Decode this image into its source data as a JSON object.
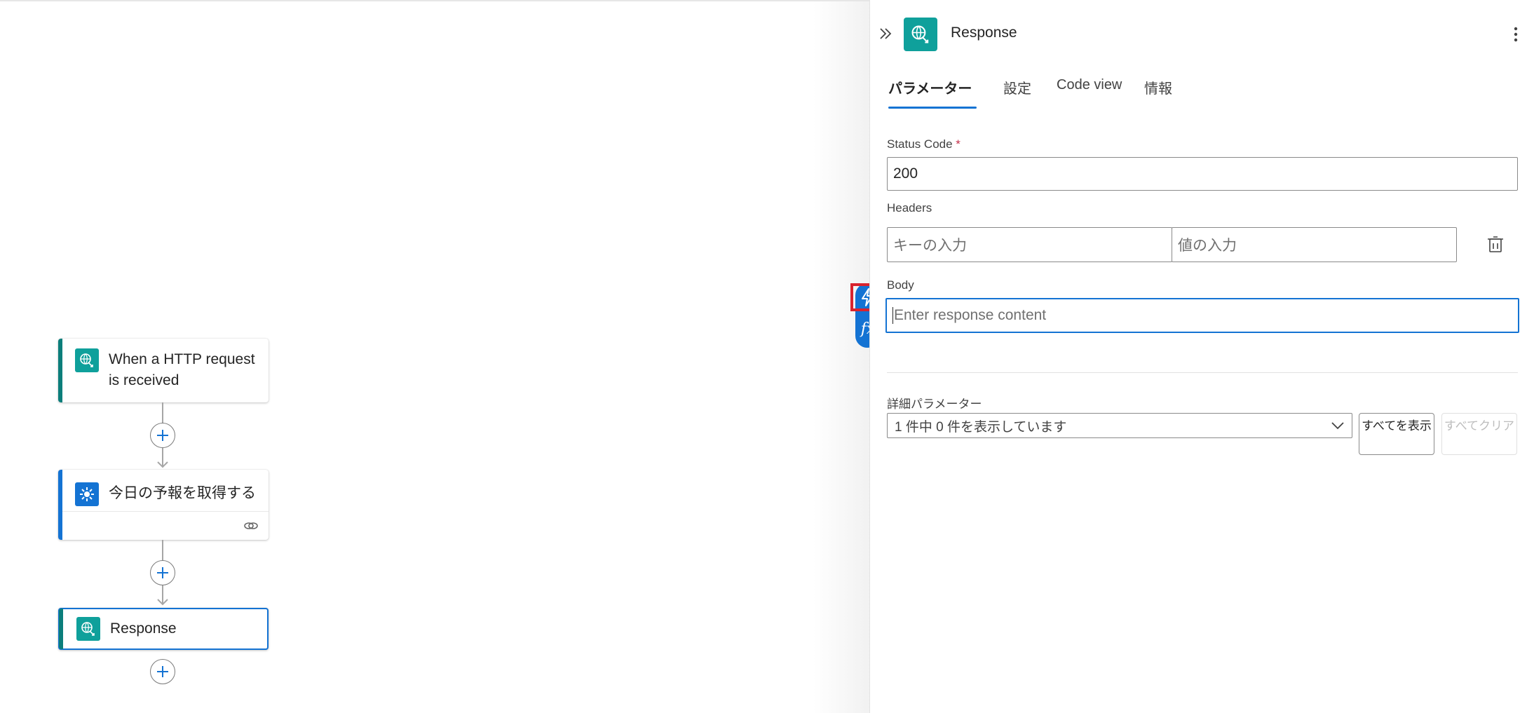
{
  "workflow": {
    "nodes": [
      {
        "title": "When a HTTP request is received",
        "icon": "http-request-icon",
        "accent": "#0b7e7b"
      },
      {
        "title": "今日の予報を取得する",
        "icon": "weather-sun-icon",
        "accent": "#1473d3"
      },
      {
        "title": "Response",
        "icon": "http-request-icon",
        "accent": "#0b7e7b"
      }
    ]
  },
  "panel": {
    "title": "Response",
    "tabs": [
      {
        "label": "パラメーター",
        "active": true
      },
      {
        "label": "設定",
        "active": false
      },
      {
        "label": "Code view",
        "active": false
      },
      {
        "label": "情報",
        "active": false
      }
    ],
    "status_code": {
      "label": "Status Code",
      "required_mark": "*",
      "value": "200"
    },
    "headers": {
      "label": "Headers",
      "key_placeholder": "キーの入力",
      "value_placeholder": "値の入力"
    },
    "body": {
      "label": "Body",
      "placeholder": "Enter response content"
    },
    "advanced": {
      "label": "詳細パラメーター",
      "selected": "1 件中 0 件を表示しています",
      "show_all": "すべてを表示",
      "clear_all": "すべてクリア"
    }
  },
  "colors": {
    "accent": "#1473d3",
    "teal": "#0fa09b",
    "highlight": "#d9232e"
  }
}
